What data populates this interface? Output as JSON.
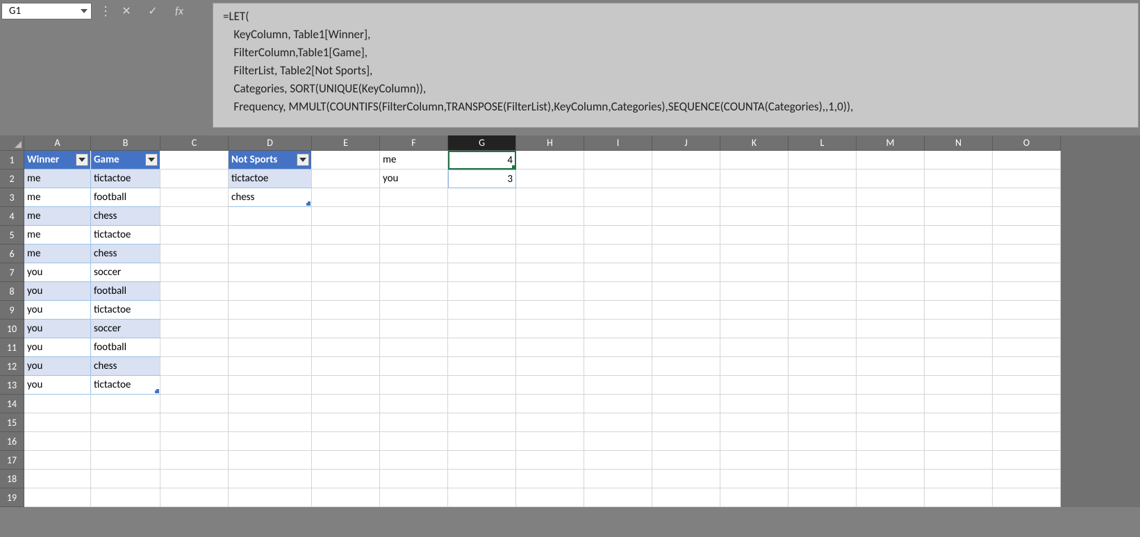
{
  "name_box": {
    "value": "G1"
  },
  "formula_bar": {
    "fx_label": "fx",
    "text": "=LET(\n    KeyColumn, Table1[Winner],\n    FilterColumn,Table1[Game],\n    FilterList, Table2[Not Sports],\n    Categories, SORT(UNIQUE(KeyColumn)),\n    Frequency, MMULT(COUNTIFS(FilterColumn,TRANSPOSE(FilterList),KeyColumn,Categories),SEQUENCE(COUNTA(Categories),,1,0)),"
  },
  "columns": [
    "A",
    "B",
    "C",
    "D",
    "E",
    "F",
    "G",
    "H",
    "I",
    "J",
    "K",
    "L",
    "M",
    "N",
    "O"
  ],
  "active_column": "G",
  "row_count": 19,
  "table1": {
    "headers": {
      "A": "Winner",
      "B": "Game"
    },
    "rows": [
      {
        "A": "me",
        "B": "tictactoe"
      },
      {
        "A": "me",
        "B": "football"
      },
      {
        "A": "me",
        "B": "chess"
      },
      {
        "A": "me",
        "B": "tictactoe"
      },
      {
        "A": "me",
        "B": "chess"
      },
      {
        "A": "you",
        "B": "soccer"
      },
      {
        "A": "you",
        "B": "football"
      },
      {
        "A": "you",
        "B": "tictactoe"
      },
      {
        "A": "you",
        "B": "soccer"
      },
      {
        "A": "you",
        "B": "football"
      },
      {
        "A": "you",
        "B": "chess"
      },
      {
        "A": "you",
        "B": "tictactoe"
      }
    ]
  },
  "table2": {
    "headers": {
      "D": "Not Sports"
    },
    "rows": [
      {
        "D": "tictactoe"
      },
      {
        "D": "chess"
      }
    ]
  },
  "results": {
    "F1": "me",
    "F2": "you",
    "G1": "4",
    "G2": "3"
  }
}
